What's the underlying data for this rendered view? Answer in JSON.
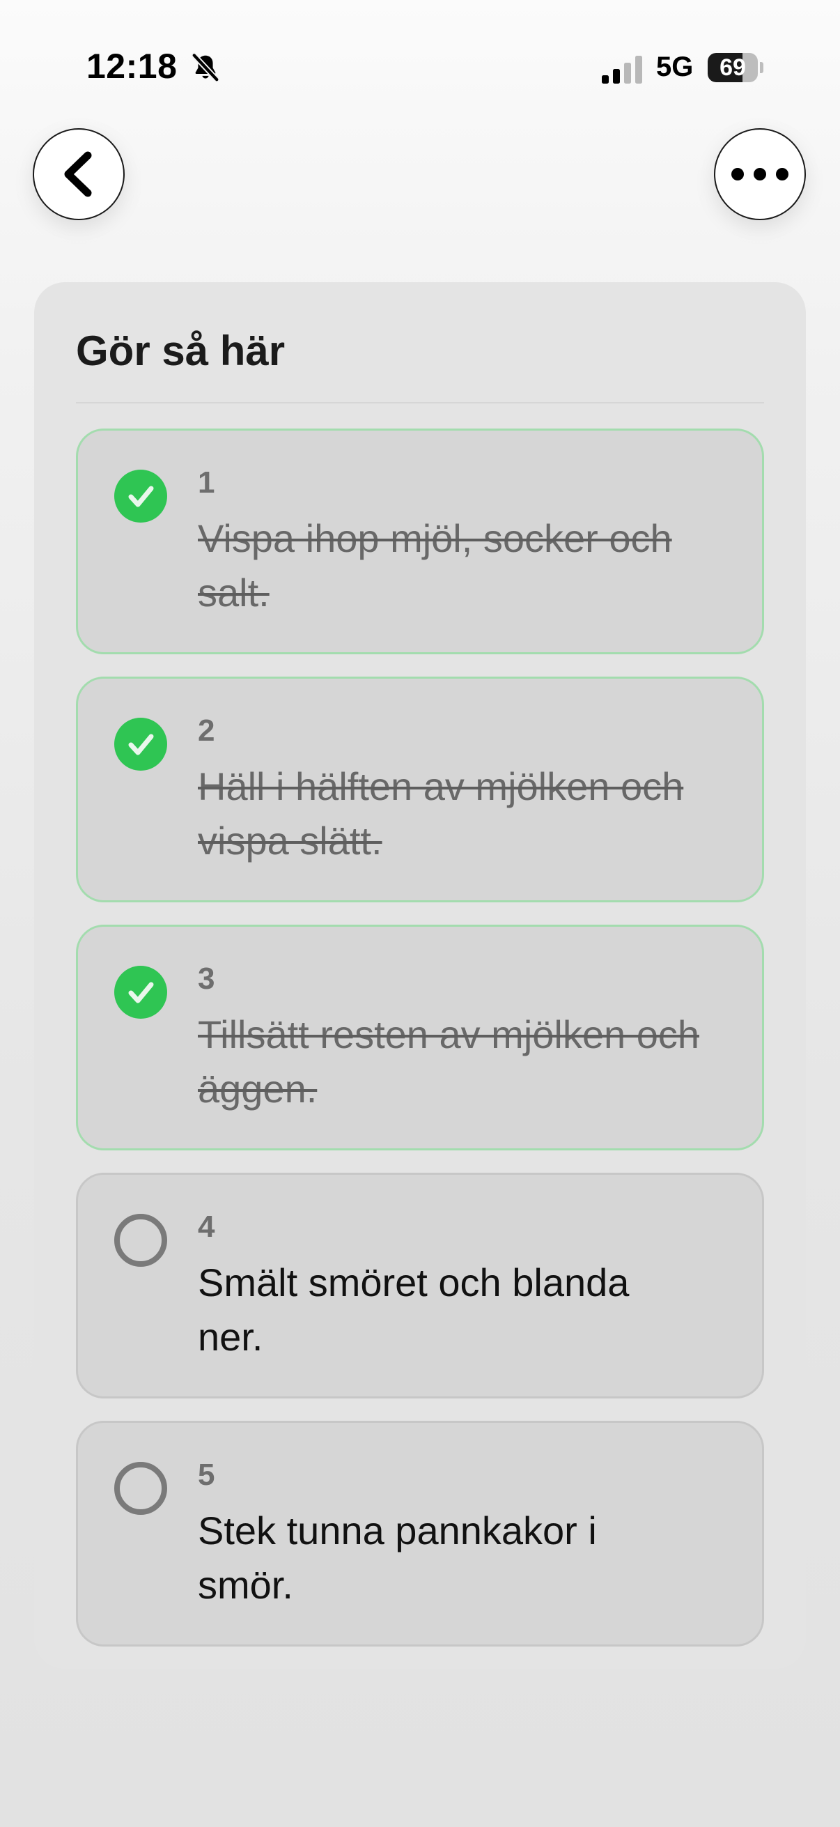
{
  "status_bar": {
    "time": "12:18",
    "network": "5G",
    "battery_level": "69",
    "battery_fraction": 0.69
  },
  "nav": {
    "back_icon": "chevron-left-icon",
    "more_icon": "ellipsis-icon"
  },
  "section": {
    "title": "Gör så här"
  },
  "colors": {
    "done_green": "#2fc553",
    "done_border": "#a3dcae",
    "card_bg": "#e4e4e4",
    "step_bg": "#d6d6d6"
  },
  "steps": [
    {
      "number": "1",
      "text": "Vispa ihop mjöl, socker och salt.",
      "done": true
    },
    {
      "number": "2",
      "text": "Häll i hälften av mjölken och vispa slätt.",
      "done": true
    },
    {
      "number": "3",
      "text": "Tillsätt resten av mjölken och äggen.",
      "done": true
    },
    {
      "number": "4",
      "text": "Smält smöret och blanda ner.",
      "done": false
    },
    {
      "number": "5",
      "text": "Stek tunna pannkakor i smör.",
      "done": false
    }
  ]
}
